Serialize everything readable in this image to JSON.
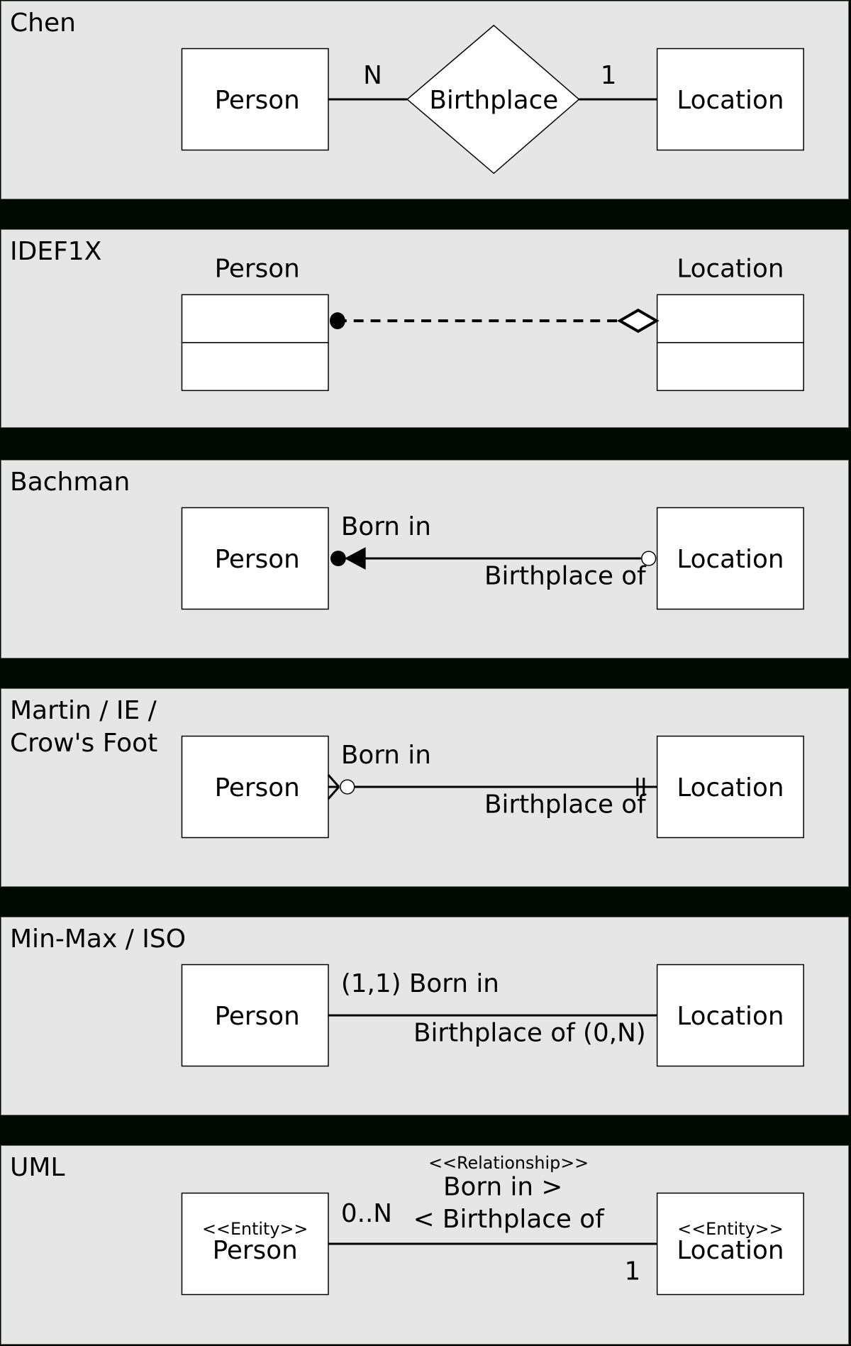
{
  "colors": {
    "background": "#000a00",
    "panel": "#e6e6e6",
    "entity_fill": "#ffffff",
    "stroke": "#000000"
  },
  "panels": [
    {
      "notation": "Chen",
      "entity_left": "Person",
      "entity_right": "Location",
      "relationship": "Birthplace",
      "cardinality_left": "N",
      "cardinality_right": "1"
    },
    {
      "notation": "IDEF1X",
      "entity_left": "Person",
      "entity_right": "Location"
    },
    {
      "notation": "Bachman",
      "entity_left": "Person",
      "entity_right": "Location",
      "label_forward": "Born in",
      "label_reverse": "Birthplace of"
    },
    {
      "notation": "Martin / IE /\nCrow's Foot",
      "entity_left": "Person",
      "entity_right": "Location",
      "label_forward": "Born in",
      "label_reverse": "Birthplace of"
    },
    {
      "notation": "Min-Max / ISO",
      "entity_left": "Person",
      "entity_right": "Location",
      "label_forward": "(1,1) Born in",
      "label_reverse": "Birthplace of (0,N)"
    },
    {
      "notation": "UML",
      "stereotype_entity": "<<Entity>>",
      "stereotype_relationship": "<<Relationship>>",
      "entity_left": "Person",
      "entity_right": "Location",
      "label_forward": "Born in >",
      "label_reverse": "< Birthplace of",
      "multiplicity_left": "0..N",
      "multiplicity_right": "1"
    }
  ]
}
